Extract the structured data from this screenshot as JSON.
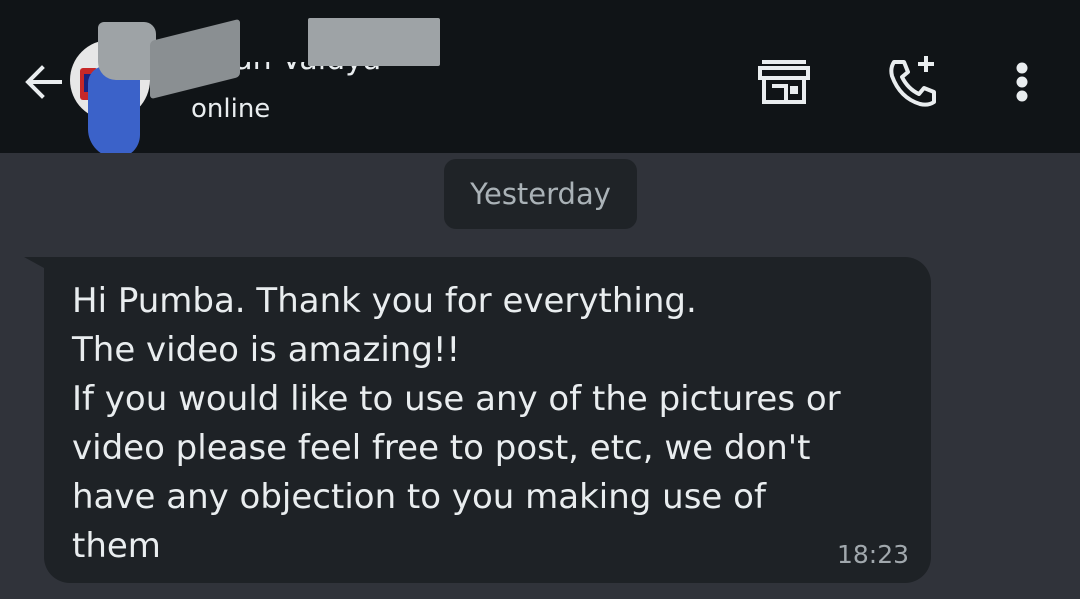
{
  "header": {
    "contact_name": "Jagan Vaidya",
    "status": "online",
    "icons": {
      "back": "arrow-left-icon",
      "shop": "storefront-icon",
      "call": "add-call-icon",
      "menu": "more-vertical-icon"
    }
  },
  "chat": {
    "date_separator": "Yesterday",
    "messages": [
      {
        "text": "Hi Pumba. Thank you for everything.\nThe video is amazing!!\nIf you would like to use any of the pictures or\nvideo please feel free to post, etc, we don't\nhave any objection to you making use of\nthem",
        "time": "18:23"
      }
    ]
  },
  "colors": {
    "header_bg": "#101417",
    "chat_bg": "#30333a",
    "bubble_bg": "#1e2226",
    "text_primary": "#e9edef",
    "text_secondary": "#a1a8ad"
  }
}
